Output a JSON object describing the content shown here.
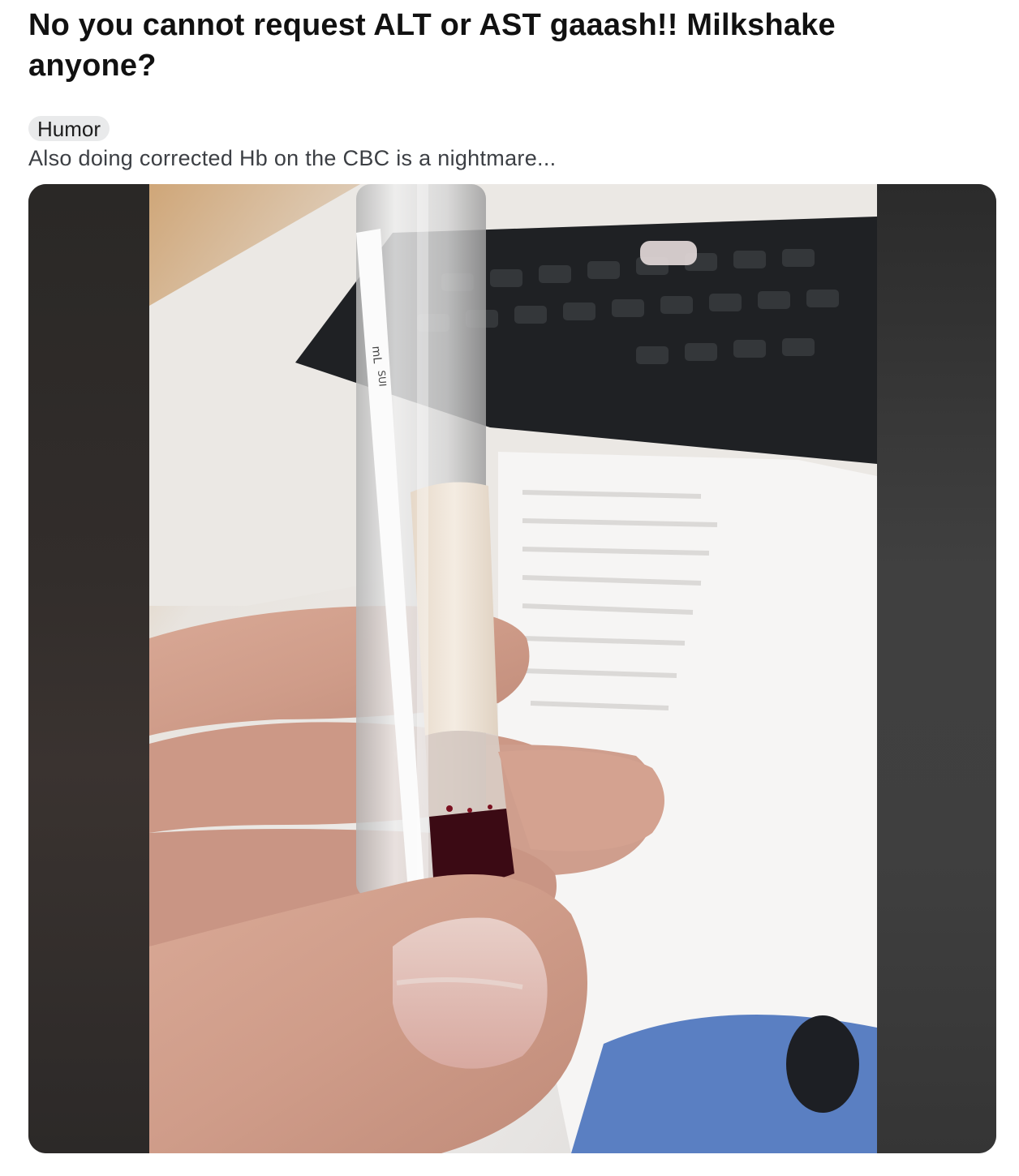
{
  "post": {
    "title": "No you cannot request ALT or AST gaaash!! Milkshake anyone?",
    "flair": "Humor",
    "body": "Also doing corrected Hb on the CBC is a nightmare...",
    "image": {
      "tube_label_text": "mL",
      "tube_label_text2": "SUI"
    }
  }
}
